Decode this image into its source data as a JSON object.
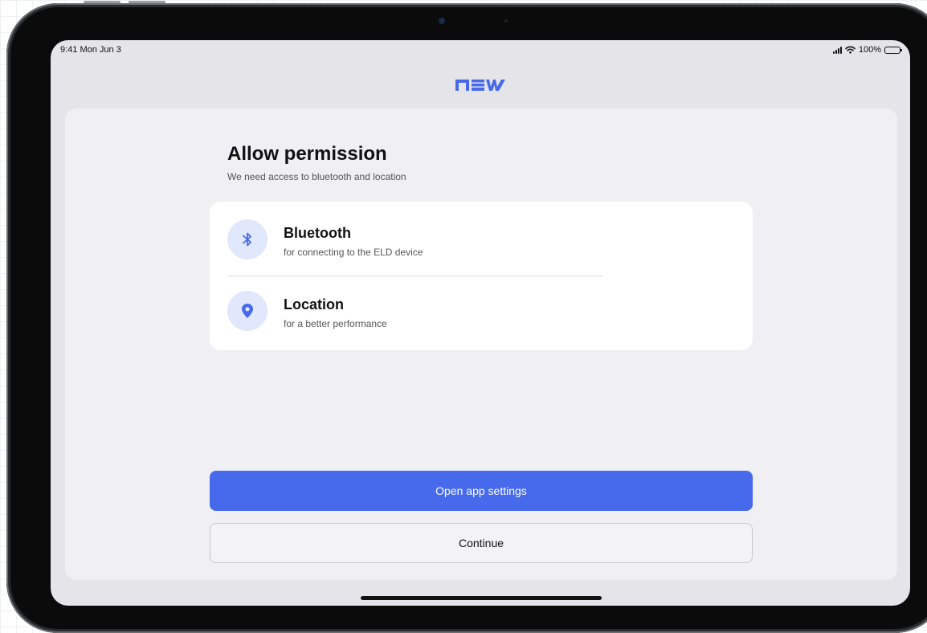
{
  "status_bar": {
    "time": "9:41 Mon Jun 3",
    "battery": "100%"
  },
  "brand": {
    "name": "new",
    "color": "#4769ec"
  },
  "page": {
    "title": "Allow permission",
    "subtitle": "We need access to bluetooth and location"
  },
  "permissions": [
    {
      "icon": "bluetooth-icon",
      "name": "Bluetooth",
      "description": "for connecting to the ELD device"
    },
    {
      "icon": "location-pin-icon",
      "name": "Location",
      "description": "for a better performance"
    }
  ],
  "actions": {
    "primary": "Open app settings",
    "secondary": "Continue"
  },
  "colors": {
    "accent": "#4769ec",
    "icon_bg": "#e1e8fb",
    "screen_bg": "#e4e4e9",
    "card_bg": "#efeff4"
  }
}
